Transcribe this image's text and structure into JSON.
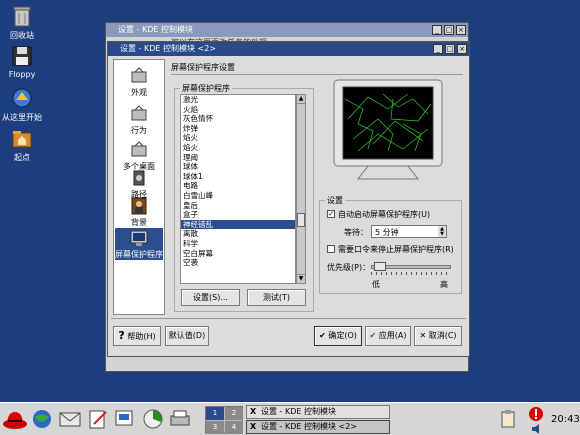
{
  "desktop": {
    "icons": [
      {
        "label": "回收站",
        "icon": "trash-icon"
      },
      {
        "label": "Floppy",
        "icon": "floppy-icon"
      },
      {
        "label": "从这里开始",
        "icon": "start-here-icon"
      },
      {
        "label": "起点",
        "icon": "home-folder-icon"
      }
    ]
  },
  "back_window": {
    "title": "设置 - KDE 控制模块",
    "partial_text": "可以在这里更改任务的外观"
  },
  "window": {
    "title": "设置 - KDE 控制模块 <2>",
    "nav": [
      {
        "label": "外观",
        "icon": "appearance-icon"
      },
      {
        "label": "行为",
        "icon": "behavior-icon"
      },
      {
        "label": "多个桌面",
        "icon": "multiple-desktops-icon"
      },
      {
        "label": "路径",
        "icon": "paths-icon"
      },
      {
        "label": "背景",
        "icon": "background-icon"
      },
      {
        "label": "屏幕保护程序",
        "icon": "screensaver-icon",
        "selected": true
      }
    ],
    "section_title": "屏幕保护程序设置",
    "screensaver_group": {
      "label": "屏幕保护程序",
      "items": [
        "激光",
        "火焰",
        "灰色情怀",
        "炸弹",
        "焰火",
        "焰火",
        "理阈",
        "球体",
        "球体1",
        "电路",
        "白雪山峰",
        "皇后",
        "盒子",
        "神经错乱",
        "离散",
        "科学",
        "空白屏幕",
        "空袭"
      ],
      "selected_index": 13,
      "setup_button": "设置(S)...",
      "test_button": "测试(T)"
    },
    "settings_group": {
      "label": "设置",
      "auto_start_label": "自动启动屏幕保护程序(U)",
      "auto_start_checked": true,
      "wait_label": "等待：",
      "wait_value": "5 分钟",
      "require_password_label": "需要口令来停止屏幕保护程序(R)",
      "require_password_checked": false,
      "priority_label": "优先级(P)：",
      "priority_low": "低",
      "priority_high": "高",
      "priority_level": 0.05
    },
    "buttons": {
      "help": "帮助(H)",
      "default": "默认值(D)",
      "ok": "确定(O)",
      "apply": "应用(A)",
      "cancel": "取消(C)"
    }
  },
  "taskbar": {
    "pager": [
      "1",
      "2",
      "3",
      "4"
    ],
    "tasks": [
      "设置 - KDE 控制模块",
      "设置 - KDE 控制模块 <2>"
    ],
    "clock": "20:43"
  },
  "colors": {
    "desktop": "#1c3e7e",
    "title_active": "#2a4a8c",
    "selection": "#2c4e8e",
    "preview_green": "#2cd12c"
  }
}
